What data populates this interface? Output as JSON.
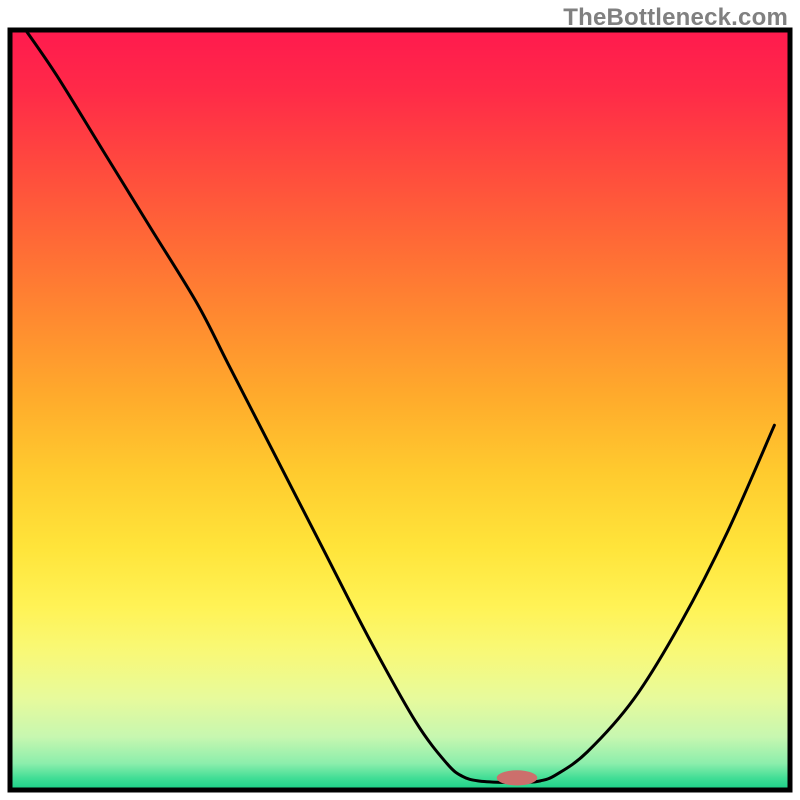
{
  "watermark": "TheBottleneck.com",
  "chart_data": {
    "type": "line",
    "title": "",
    "xlabel": "",
    "ylabel": "",
    "xlim": [
      0,
      100
    ],
    "ylim": [
      0,
      100
    ],
    "border": true,
    "background_gradient_stops": [
      {
        "offset": 0.0,
        "color": "#ff1a4e"
      },
      {
        "offset": 0.08,
        "color": "#ff2a48"
      },
      {
        "offset": 0.18,
        "color": "#ff4a3e"
      },
      {
        "offset": 0.28,
        "color": "#ff6a36"
      },
      {
        "offset": 0.38,
        "color": "#ff8a30"
      },
      {
        "offset": 0.48,
        "color": "#ffaa2c"
      },
      {
        "offset": 0.58,
        "color": "#ffca2e"
      },
      {
        "offset": 0.68,
        "color": "#ffe43a"
      },
      {
        "offset": 0.76,
        "color": "#fff356"
      },
      {
        "offset": 0.82,
        "color": "#f8f978"
      },
      {
        "offset": 0.88,
        "color": "#e7fa9c"
      },
      {
        "offset": 0.93,
        "color": "#c7f7b0"
      },
      {
        "offset": 0.965,
        "color": "#8ceeac"
      },
      {
        "offset": 0.985,
        "color": "#3fdd95"
      },
      {
        "offset": 1.0,
        "color": "#18cf87"
      }
    ],
    "curve": {
      "x": [
        2,
        6,
        12,
        18,
        24,
        28,
        34,
        40,
        46,
        52,
        56,
        58,
        60,
        63,
        66,
        68,
        70,
        74,
        80,
        86,
        92,
        98
      ],
      "y": [
        100,
        94,
        84,
        74,
        64,
        56,
        44,
        32,
        20,
        9,
        3.5,
        1.8,
        1.2,
        1.0,
        1.0,
        1.2,
        2.0,
        5,
        12,
        22,
        34,
        48
      ]
    },
    "marker": {
      "x": 65,
      "y": 1.6,
      "color": "#cc6f6c",
      "rx": 2.6,
      "ry": 1.0
    },
    "axis_line_y": 0
  }
}
